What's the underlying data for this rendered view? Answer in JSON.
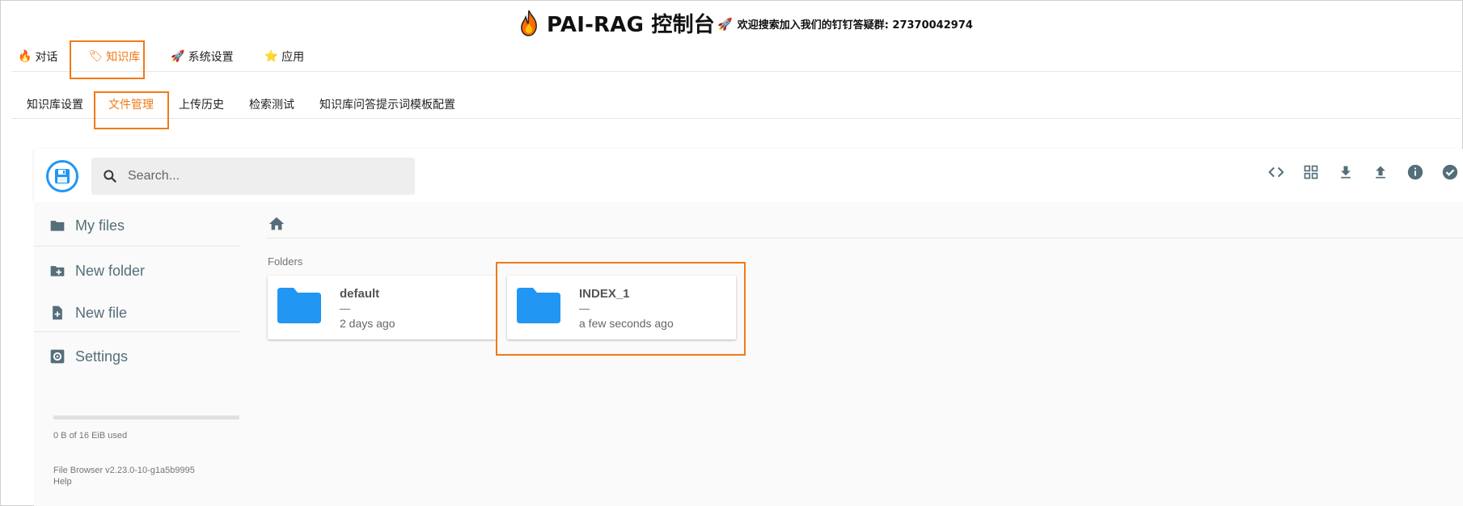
{
  "header": {
    "title": "PAI-RAG 控制台",
    "notice": "欢迎搜索加入我们的钉钉答疑群: 27370042974"
  },
  "main_tabs": [
    {
      "label": "对话",
      "icon": "fire-icon"
    },
    {
      "label": "知识库",
      "icon": "tag-icon"
    },
    {
      "label": "系统设置",
      "icon": "rocket-icon"
    },
    {
      "label": "应用",
      "icon": "star-icon"
    }
  ],
  "main_tabs_active": "知识库",
  "sub_tabs": [
    {
      "label": "知识库设置"
    },
    {
      "label": "文件管理"
    },
    {
      "label": "上传历史"
    },
    {
      "label": "检索测试"
    },
    {
      "label": "知识库问答提示词模板配置"
    }
  ],
  "sub_tabs_active": "文件管理",
  "file_browser": {
    "search_placeholder": "Search...",
    "actions": [
      "code-icon",
      "grid-view-icon",
      "download-icon",
      "upload-icon",
      "info-icon",
      "check-circle-icon"
    ],
    "sidebar": {
      "items": [
        {
          "label": "My files",
          "icon": "folder-icon"
        },
        {
          "label": "New folder",
          "icon": "new-folder-icon"
        },
        {
          "label": "New file",
          "icon": "new-file-icon"
        },
        {
          "label": "Settings",
          "icon": "settings-icon"
        }
      ],
      "usage": "0 B of 16 EiB used",
      "version": "File Browser v2.23.0-10-g1a5b9995",
      "help": "Help"
    },
    "section_label": "Folders",
    "folders": [
      {
        "name": "default",
        "size": "—",
        "modified": "2 days ago"
      },
      {
        "name": "INDEX_1",
        "size": "—",
        "modified": "a few seconds ago"
      }
    ]
  },
  "colors": {
    "accent": "#f07a17",
    "folder_blue": "#2196f3",
    "sidebar_text": "#546e7a"
  }
}
